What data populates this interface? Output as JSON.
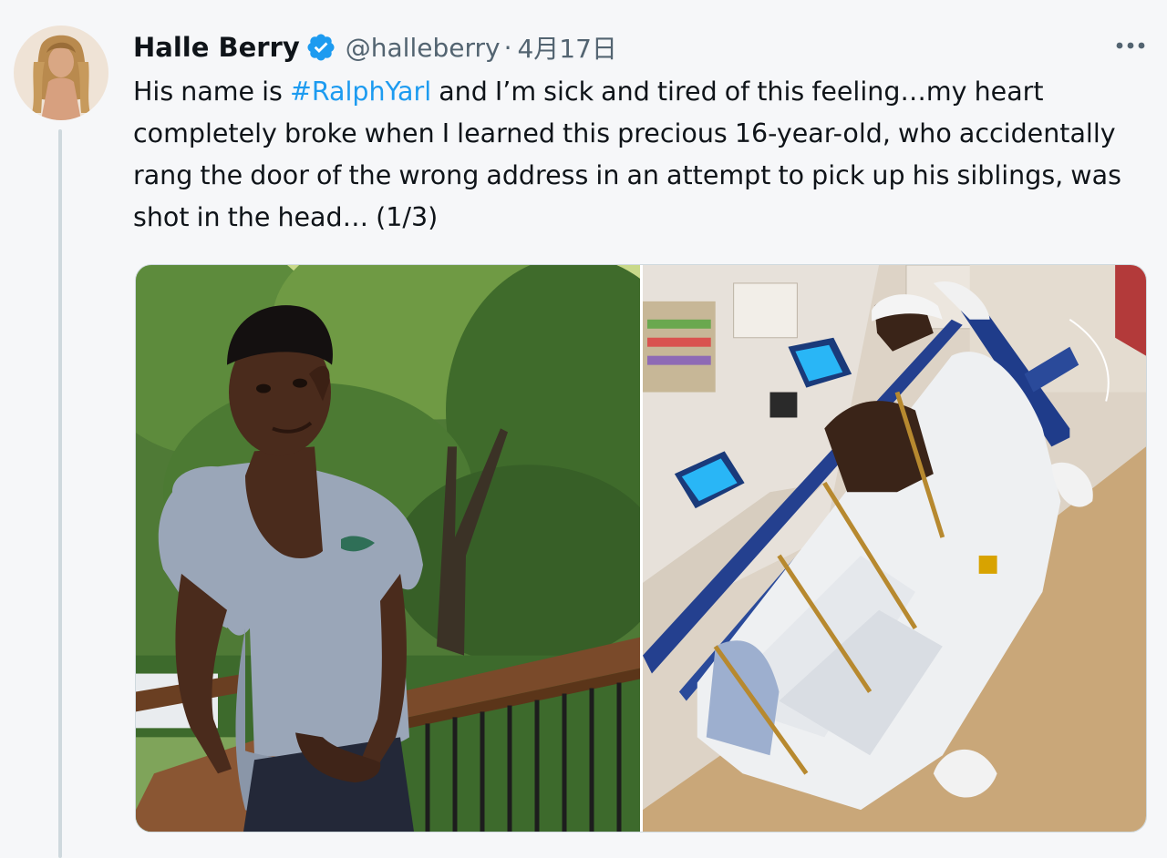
{
  "tweet": {
    "author_name": "Halle Berry",
    "handle": "@halleberry",
    "separator": "·",
    "date": "4月17日",
    "text_before": "His name is ",
    "hashtag": "#RalphYarl",
    "text_after": " and I’m sick and tired of this feeling…my heart completely broke when I learned this precious 16-year-old, who accidentally rang the door of the wrong address in an attempt to pick up his siblings, was shot in the head… (1/3)",
    "icons": {
      "verified": "verified-badge-icon",
      "more": "more-options-icon"
    },
    "colors": {
      "accent": "#1d9bf0",
      "secondary_text": "#536471",
      "background": "#f6f7f9"
    }
  }
}
